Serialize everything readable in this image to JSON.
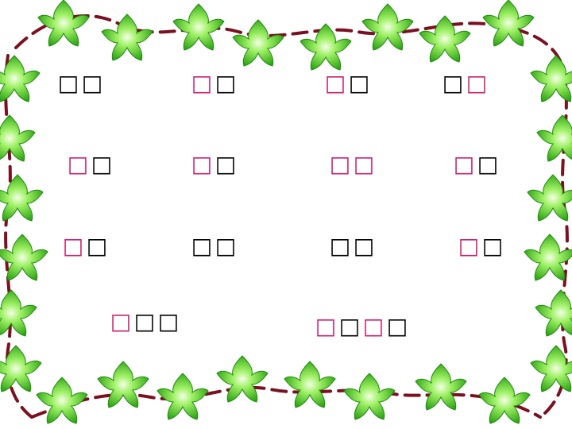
{
  "colors": {
    "accent": "#cc1f6e",
    "text": "#000000",
    "vine": "#7a1020",
    "leaf": "#3cc81e"
  },
  "icons": {
    "border": "leaf-vine-border-icon"
  },
  "words": [
    [
      {
        "t": "□",
        "c": "black"
      },
      {
        "t": "□",
        "c": "black"
      }
    ],
    [
      {
        "t": "□",
        "c": "pink"
      },
      {
        "t": "□",
        "c": "black"
      }
    ],
    [
      {
        "t": "□",
        "c": "pink"
      },
      {
        "t": "□",
        "c": "black"
      }
    ],
    [
      {
        "t": "□",
        "c": "black"
      },
      {
        "t": "□",
        "c": "pink"
      }
    ],
    [
      {
        "t": "□",
        "c": "pink"
      },
      {
        "t": "□",
        "c": "black"
      }
    ],
    [
      {
        "t": "□",
        "c": "pink"
      },
      {
        "t": "□",
        "c": "black"
      }
    ],
    [
      {
        "t": "□",
        "c": "pink"
      },
      {
        "t": "□",
        "c": "pink"
      }
    ],
    [
      {
        "t": "□",
        "c": "pink"
      },
      {
        "t": "□",
        "c": "black"
      }
    ],
    [
      {
        "t": "□",
        "c": "pink"
      },
      {
        "t": "□",
        "c": "black"
      }
    ],
    [
      {
        "t": "□",
        "c": "black"
      },
      {
        "t": "□",
        "c": "black"
      }
    ],
    [
      {
        "t": "□",
        "c": "black"
      },
      {
        "t": "□",
        "c": "black"
      }
    ],
    [
      {
        "t": "□",
        "c": "pink"
      },
      {
        "t": "□",
        "c": "black"
      }
    ],
    [
      {
        "t": "□",
        "c": "pink"
      },
      {
        "t": "□",
        "c": "black"
      },
      {
        "t": "□",
        "c": "black"
      }
    ],
    [
      {
        "t": "□",
        "c": "pink"
      },
      {
        "t": "□",
        "c": "black"
      },
      {
        "t": "□",
        "c": "pink"
      },
      {
        "t": "□",
        "c": "black"
      }
    ]
  ]
}
